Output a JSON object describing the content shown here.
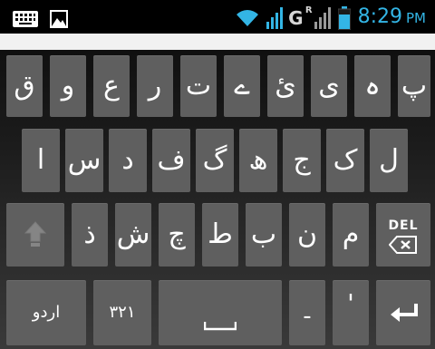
{
  "status_bar": {
    "icons_left": [
      "keyboard-icon",
      "image-icon"
    ],
    "icons_right": [
      "wifi-icon",
      "signal-icon",
      "battery-icon"
    ],
    "network_type": "G",
    "roaming_mark": "R",
    "time": "8:29",
    "ampm": "PM",
    "time_color": "#33b5e5"
  },
  "keyboard": {
    "key_color": "#5f5f5f",
    "rows": [
      [
        "پ",
        "ہ",
        "ی",
        "ئ",
        "ے",
        "ت",
        "ر",
        "ع",
        "و",
        "ق"
      ],
      [
        "ل",
        "ک",
        "ج",
        "ھ",
        "گ",
        "ف",
        "د",
        "س",
        "ا"
      ],
      [
        "م",
        "ن",
        "ب",
        "ط",
        "چ",
        "ش",
        "ذ"
      ]
    ],
    "special": {
      "shift": "shift-icon",
      "delete_label": "DEL",
      "language_label": "اردو",
      "numbers_label": "۳۲۱",
      "space_icon": "space-icon",
      "period": "-",
      "comma": "'",
      "enter": "enter-icon"
    }
  }
}
